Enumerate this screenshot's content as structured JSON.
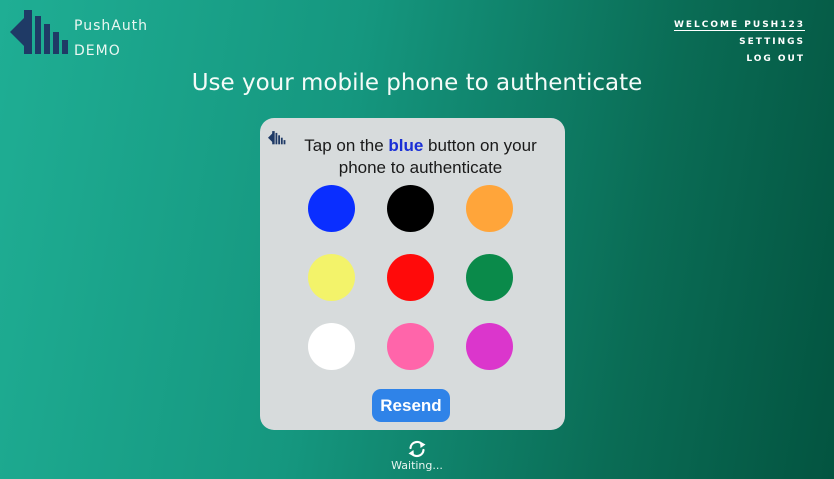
{
  "brand": {
    "name": "PushAuth",
    "subtitle": "DEMO"
  },
  "nav": {
    "welcome": "WELCOME PUSH123",
    "settings": "SETTINGS",
    "logout": "LOG OUT"
  },
  "headline": "Use your mobile phone to authenticate",
  "card": {
    "prompt_before": "Tap on the ",
    "prompt_color_word": "blue",
    "prompt_after": " button on your phone to authenticate",
    "colors": [
      {
        "name": "blue",
        "hex": "#0a2eff"
      },
      {
        "name": "black",
        "hex": "#000000"
      },
      {
        "name": "orange",
        "hex": "#ffa53a"
      },
      {
        "name": "yellow",
        "hex": "#f3f36a"
      },
      {
        "name": "red",
        "hex": "#ff0a0a"
      },
      {
        "name": "green",
        "hex": "#0a8a4a"
      },
      {
        "name": "white",
        "hex": "#ffffff"
      },
      {
        "name": "pink",
        "hex": "#ff65aa"
      },
      {
        "name": "magenta",
        "hex": "#db36cc"
      }
    ],
    "resend_label": "Resend"
  },
  "status": {
    "icon": "refresh-icon",
    "text": "Waiting..."
  },
  "theme": {
    "accent": "#2f83e8",
    "logo_color": "#1f3a66"
  }
}
